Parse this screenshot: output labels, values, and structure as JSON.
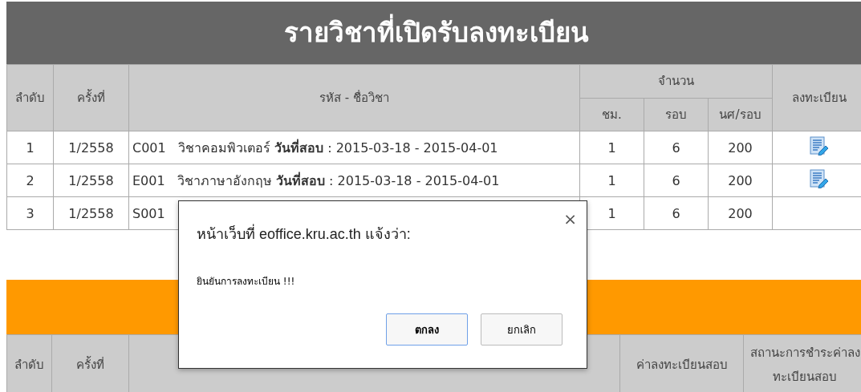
{
  "open_courses": {
    "title": "รายวิชาที่เปิดรับลงทะเบียน",
    "columns": {
      "order": "ลำดับ",
      "term": "ครั้งที่",
      "course": "รหัส - ชื่อวิชา",
      "amount": "จำนวน",
      "hours": "ชม.",
      "rounds": "รอบ",
      "per_round": "นศ/รอบ",
      "register": "ลงทะเบียน"
    },
    "rows": [
      {
        "order": "1",
        "term": "1/2558",
        "course": "C001   วิชาคอมพิวเตอร์ **วันที่สอบ** : 2015-03-18 - 2015-04-01",
        "hours": "1",
        "rounds": "6",
        "per_round": "200",
        "can_register": true
      },
      {
        "order": "2",
        "term": "1/2558",
        "course": "E001   วิชาภาษาอังกฤษ **วันที่สอบ** : 2015-03-18 - 2015-04-01",
        "hours": "1",
        "rounds": "6",
        "per_round": "200",
        "can_register": true
      },
      {
        "order": "3",
        "term": "1/2558",
        "course": "S001",
        "hours": "1",
        "rounds": "6",
        "per_round": "200",
        "can_register": false
      }
    ]
  },
  "registered": {
    "columns": {
      "order": "ลำดับ",
      "term": "ครั้งที่",
      "fee": "ค่าลงทะเบียนสอบ",
      "status": "สถานะการชำระค่าลงทะเบียนสอบ"
    }
  },
  "dialog": {
    "title": "หน้าเว็บที่ eoffice.kru.ac.th แจ้งว่า:",
    "close": "×",
    "message": "ยินยันการลงทะเบียน !!!",
    "buttons": [
      {
        "label": "ตกลง",
        "focused": true
      },
      {
        "label": "ยกเลิก",
        "focused": false
      }
    ]
  }
}
